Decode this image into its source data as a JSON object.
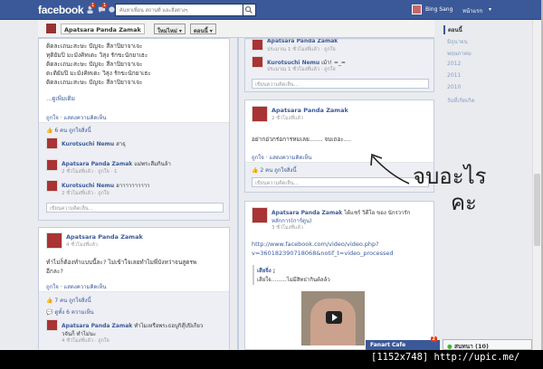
{
  "header": {
    "logo": "facebook",
    "badge_friends": "1",
    "badge_messages": "1",
    "search_placeholder": "ค้นหาเพื่อน สถานที่ และสิ่งต่างๆ",
    "user_name": "Bing Sang",
    "home_label": "หน้าแรก"
  },
  "cover_bar": {
    "name": "Apatsara Panda Zamak",
    "button_new": "ใหม่ไหม่",
    "button_now": "ตอนนี้"
  },
  "left_col": {
    "post1_lines": [
      "ติดละเถนะสะษะ ปัญจะ สีลาปิยาจาเจะ",
      "ทุติยัมปิ มะมังคิทเตะ วิสุง รักขะนักยาเธะ",
      "ติดละเถนะสะษะ ปัญจะ สีลาปิยาจาเจะ",
      "ตะติยัมปิ มะมังคิทเตะ วิสุง รักขะนักยาเธะ",
      "ติดละเถนะสะษะ ปัญจะ สีลาปิยาจาเจะ"
    ],
    "see_more": "...ดูเพิ่มเติม",
    "post1_actions": "ถูกใจ · แสดงความคิดเห็น",
    "post1_likes": "6 คน ถูกใจสิ่งนี้",
    "comments": [
      {
        "name": "Kurotsuchi Nemu",
        "text": "สาธุ",
        "meta": ""
      },
      {
        "name": "Apatsara Panda Zamak",
        "text": "แม่พระลืมกินล้า",
        "meta": "2 ชั่วโมงที่แล้ว · ถูกใจ · 1"
      },
      {
        "name": "Kurotsuchi Nemu",
        "text": "ฮาาาาาาาาาา",
        "meta": "2 ชั่วโมงที่แล้ว · ถูกใจ"
      }
    ],
    "comment_placeholder": "เขียนความคิดเห็น...",
    "post2_name": "Apatsara Panda Zamak",
    "post2_time": "4 ชั่วโมงที่แล้ว",
    "post2_text_1": "ทำไม่ก็ต้องทำแบบนี้ละ? ไม่เข้าใจเลยทำไมพี่บังหว่าจนสูตรพ",
    "post2_text_2": "อีกละ?",
    "post2_actions": "ถูกใจ · แสดงความคิดเห็น",
    "post2_likes": "7 คน ถูกใจสิ่งนี้",
    "post2_comments": "ดูทั้ง 6 ความเห็น",
    "post2_c_name": "Apatsara Panda Zamak",
    "post2_c_text": "ทำไมเหรือพระธอบูกิสุ๊ปปิเกียว",
    "post2_c_text2": "วจันก็ ทำไม่นะ",
    "post2_c_meta": "4 ชั่วโมงที่แล้ว · ถูกใจ"
  },
  "right_col": {
    "top_name": "Apatsara Panda Zamak",
    "top_meta": "ประมาณ 1 ชั่วโมงที่แล้ว · ถูกใจ",
    "top_c_name": "Kurotsuchi Nemu",
    "top_c_text": "เม้า! =_=",
    "top_c_meta": "ประมาณ 1 ชั่วโมงที่แล้ว · ถูกใจ",
    "comment_placeholder": "เขียนความคิดเห็น...",
    "post_name": "Apatsara Panda Zamak",
    "post_time": "2 ชั่วโมงที่แล้ว",
    "post_text": "อย่ากอ่วกร่อการหมเลย....... จบเถอะ....",
    "post_actions": "ถูกใจ · แสดงความคิดเห็น",
    "post_likes": "2 คน ถูกใจสิ่งนี้",
    "share_name": "Apatsara Panda Zamak",
    "share_rest": "ได้แชร์ วิดีโอ ของ นักรวารัก",
    "share_rest2": "หลักการ(การ์ตูน)",
    "share_time": "3 ชั่วโมงที่แล้ว",
    "video_url_1": "http://www.facebook.com/video/video.php?",
    "video_url_2": "v=360182390718068&notif_t=video_processed",
    "quote_title": "เสียจิ่ง ;",
    "quote_text": "เสียใจ.........ไม่มีสิทธ่ากินต้ลล้ว"
  },
  "timeline_nav": {
    "years": [
      "ตอนนี้",
      "มิถุนายน",
      "พฤษภาคม",
      "2012",
      "2011",
      "2010",
      "วันที่เกิดเกิด"
    ]
  },
  "chat": {
    "fanart_tab": "Fanart Cafe",
    "fanart_badge": "2",
    "online_label": "สนทนา (10)"
  },
  "annotation": {
    "text_line1": "จบอะไร",
    "text_line2": "คะ"
  },
  "footer_caption": "[1152x748] http://upic.me/"
}
